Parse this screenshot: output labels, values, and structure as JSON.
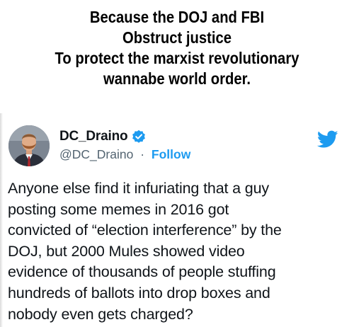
{
  "caption": {
    "lines": [
      "Because the DOJ and FBI",
      "Obstruct justice",
      "To protect the marxist revolutionary",
      "wannabe world order."
    ]
  },
  "tweet": {
    "display_name": "DC_Draino",
    "handle": "@DC_Draino",
    "separator": "·",
    "follow_label": "Follow",
    "verified_icon": "verified-badge-icon",
    "platform_icon": "twitter-bird-icon",
    "accent_color": "#1d9bf0",
    "body_lines": [
      "Anyone else find it infuriating that a guy",
      "posting some memes in 2016 got",
      "convicted of “election interference” by the",
      "DOJ, but 2000 Mules showed video",
      "evidence of thousands of people stuffing",
      "hundreds of ballots into drop boxes and",
      "nobody even gets charged?"
    ]
  }
}
